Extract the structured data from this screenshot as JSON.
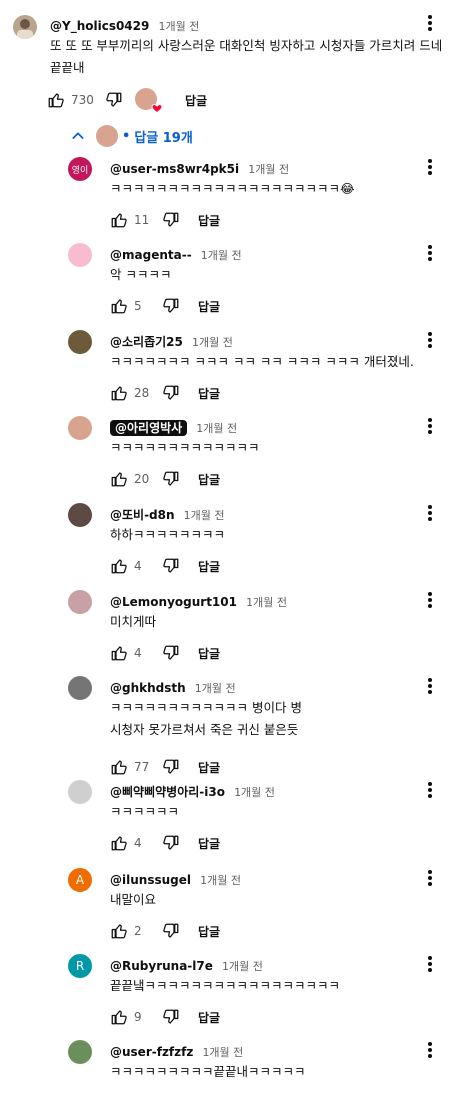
{
  "top_comment": {
    "author": "@Y_holics0429",
    "time": "1개월 전",
    "text": "또 또 또 부부끼리의 사랑스러운 대화인척 빙자하고 시청자들 가르치려 드네 끝끝내",
    "likes": "730",
    "reply_label": "답글"
  },
  "replies_toggle": {
    "bullet": "•",
    "label": "답글 19개"
  },
  "replies": [
    {
      "author": "@user-ms8wr4pk5i",
      "time": "1개월 전",
      "text": "ㅋㅋㅋㅋㅋㅋㅋㅋㅋㅋㅋㅋㅋㅋㅋㅋㅋㅋㅋㅋ😂",
      "likes": "11",
      "reply_label": "답글",
      "avatar_text": "영이",
      "avatar_color": "#c2185b"
    },
    {
      "author": "@magenta--",
      "time": "1개월 전",
      "text": "악 ㅋㅋㅋㅋ",
      "likes": "5",
      "reply_label": "답글",
      "avatar_text": "",
      "avatar_color": "#f8bbd0"
    },
    {
      "author": "@소리좁기25",
      "time": "1개월 전",
      "text": "ㅋㅋㅋㅋㅋㅋㅋ ㅋㅋㅋ ㅋㅋ ㅋㅋ ㅋㅋㅋ ㅋㅋㅋ 개터졌네.",
      "likes": "28",
      "reply_label": "답글",
      "avatar_text": "",
      "avatar_color": "#6d5a3b"
    },
    {
      "author": "@아리영박사",
      "time": "1개월 전",
      "text": "ㅋㅋㅋㅋㅋㅋㅋㅋㅋㅋㅋㅋㅋ",
      "likes": "20",
      "reply_label": "답글",
      "avatar_text": "",
      "avatar_color": "#d8a48f",
      "badge": true
    },
    {
      "author": "@또비-d8n",
      "time": "1개월 전",
      "text": "하하ㅋㅋㅋㅋㅋㅋㅋㅋ",
      "likes": "4",
      "reply_label": "답글",
      "avatar_text": "",
      "avatar_color": "#5d4a44"
    },
    {
      "author": "@Lemonyogurt101",
      "time": "1개월 전",
      "text": "미치게따",
      "likes": "4",
      "reply_label": "답글",
      "avatar_text": "",
      "avatar_color": "#c9a0a6"
    },
    {
      "author": "@ghkhdsth",
      "time": "1개월 전",
      "text": "ㅋㅋㅋㅋㅋㅋㅋㅋㅋㅋㅋㅋ 병이다 병",
      "text2": "시청자 못가르쳐서 죽은 귀신 붙은듯",
      "likes": "77",
      "reply_label": "답글",
      "avatar_text": "",
      "avatar_color": "#757575"
    },
    {
      "author": "@삐약삐약병아리-i3o",
      "time": "1개월 전",
      "text": "ㅋㅋㅋㅋㅋㅋ",
      "likes": "4",
      "reply_label": "답글",
      "avatar_text": "",
      "avatar_color": "#cfcfcf"
    },
    {
      "author": "@ilunssugel",
      "time": "1개월 전",
      "text": "내말이요",
      "likes": "2",
      "reply_label": "답글",
      "avatar_text": "A",
      "avatar_color": "#ef6c00"
    },
    {
      "author": "@Rubyruna-l7e",
      "time": "1개월 전",
      "text": "끝끝냌ㅋㅋㅋㅋㅋㅋㅋㅋㅋㅋㅋㅋㅋㅋㅋㅋㅋ",
      "likes": "9",
      "reply_label": "답글",
      "avatar_text": "R",
      "avatar_color": "#0097a7"
    },
    {
      "author": "@user-fzfzfz",
      "time": "1개월 전",
      "text": "ㅋㅋㅋㅋㅋㅋㅋㅋㅋ끝끝내ㅋㅋㅋㅋㅋ",
      "likes": "",
      "reply_label": "",
      "avatar_text": "",
      "avatar_color": "#6b8f5a"
    }
  ]
}
